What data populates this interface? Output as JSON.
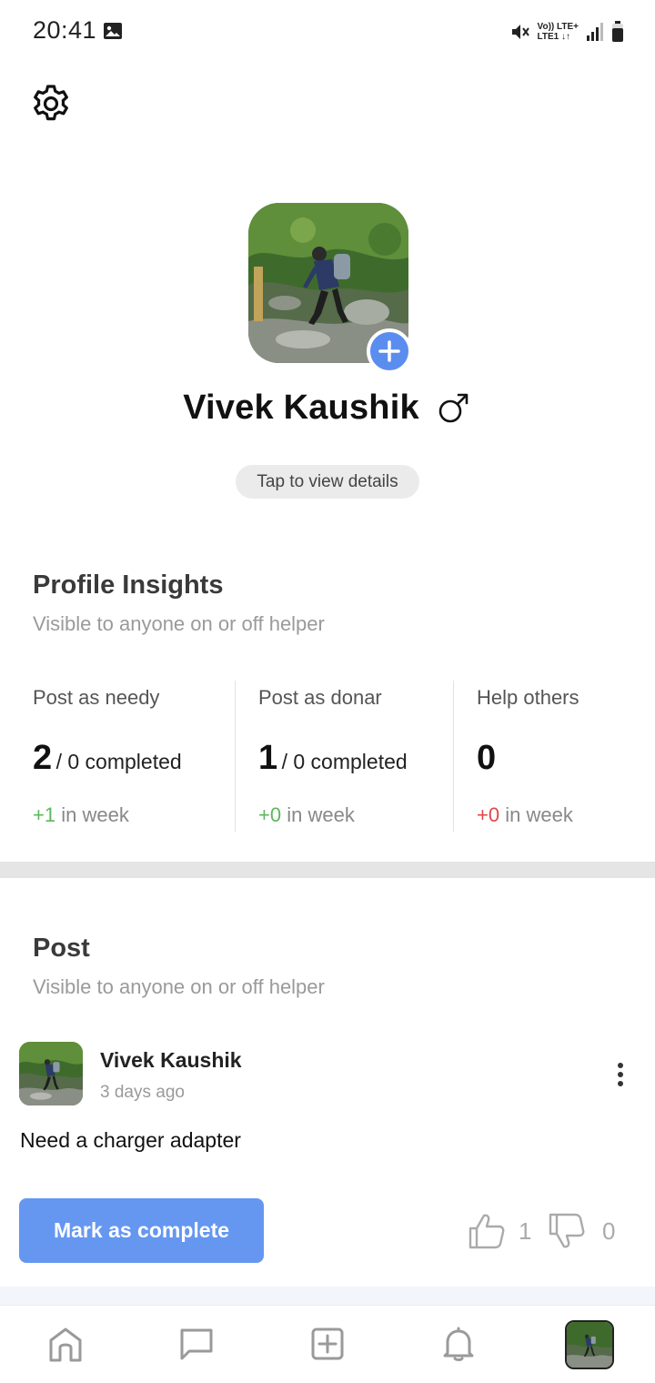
{
  "status_bar": {
    "time": "20:41",
    "network_top": "Vo)) LTE+",
    "network_bottom": "LTE1 ↓↑",
    "icons": [
      "gallery-icon",
      "mute-icon",
      "signal-icon",
      "battery-icon"
    ]
  },
  "profile": {
    "name": "Vivek Kaushik",
    "gender_icon": "male-symbol",
    "details_button": "Tap to view details"
  },
  "insights": {
    "title": "Profile Insights",
    "subtitle": "Visible to anyone on or off helper",
    "stats": [
      {
        "label": "Post as needy",
        "value": "2",
        "completed": "/ 0 completed",
        "delta": "+1",
        "delta_suffix": "in week"
      },
      {
        "label": "Post as donar",
        "value": "1",
        "completed": "/ 0 completed",
        "delta": "+0",
        "delta_suffix": "in week"
      },
      {
        "label": "Help others",
        "value": "0",
        "completed": "",
        "delta": "+0",
        "delta_suffix": "in week"
      }
    ]
  },
  "posts_section": {
    "title": "Post",
    "subtitle": "Visible to anyone on or off helper"
  },
  "post": {
    "author": "Vivek Kaushik",
    "time": "3 days ago",
    "text": "Need a charger adapter",
    "complete_button": "Mark as complete",
    "likes": "1",
    "dislikes": "0"
  },
  "colors": {
    "accent": "#5b8def",
    "button": "#6597f1",
    "positive": "#5cb85c",
    "negative": "#e04848"
  },
  "bottom_nav": [
    "home-icon",
    "chat-icon",
    "add-post-icon",
    "bell-icon",
    "profile-avatar"
  ]
}
